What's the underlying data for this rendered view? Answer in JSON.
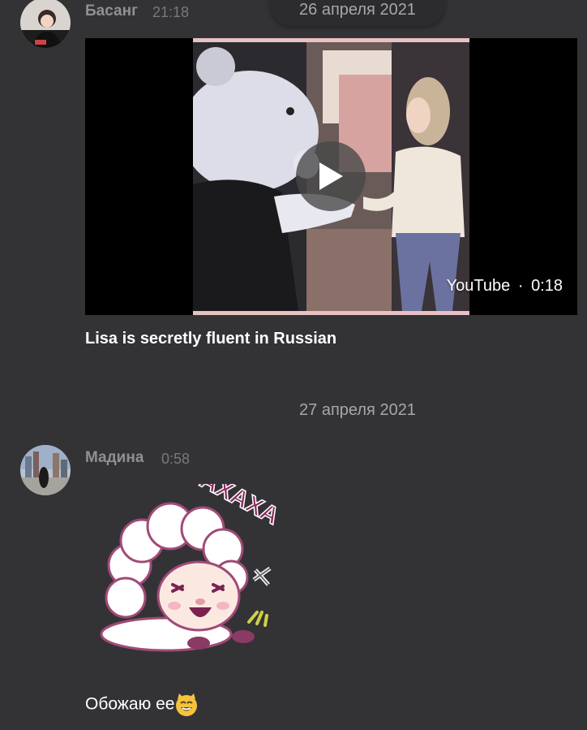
{
  "messages": [
    {
      "author": "Басанг",
      "time": "21:18",
      "video": {
        "title": "Lisa is secretly fluent in Russian",
        "source": "YouTube",
        "separator": "·",
        "duration": "0:18"
      }
    },
    {
      "author": "Мадина",
      "time": "0:58",
      "sticker": {
        "text": "АХАХА"
      },
      "text": "Обожаю ее"
    }
  ],
  "dates": {
    "first": "26 апреля 2021",
    "second": "27 апреля 2021"
  },
  "icons": {
    "play": "play-icon",
    "emoji": "smiling-cat-emoji"
  },
  "colors": {
    "background": "#333335",
    "author": "#8e9095",
    "time": "#76787d",
    "text": "#ffffff",
    "video_border": "#e8c1c3"
  }
}
